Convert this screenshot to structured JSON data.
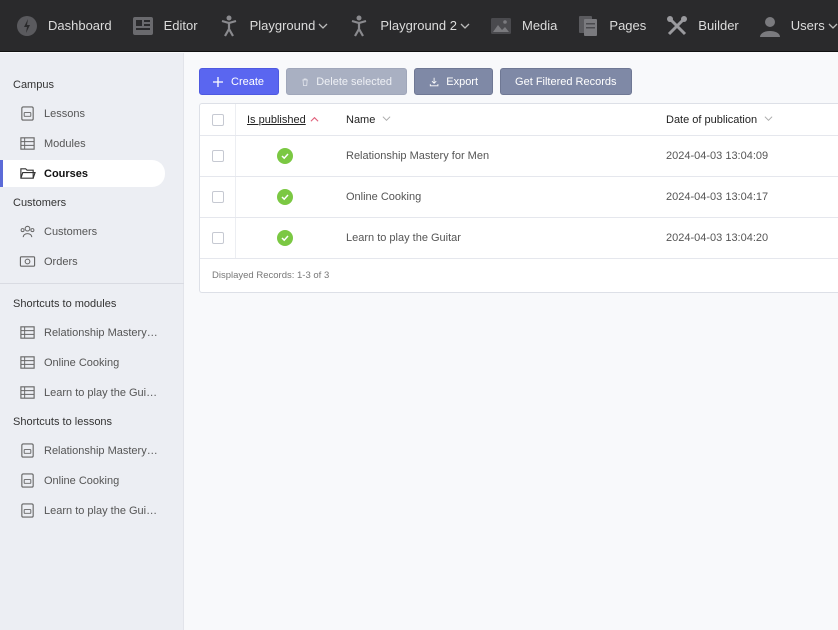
{
  "nav": [
    {
      "label": "Dashboard",
      "icon": "dashboard-icon",
      "dropdown": false
    },
    {
      "label": "Editor",
      "icon": "editor-icon",
      "dropdown": false
    },
    {
      "label": "Playground",
      "icon": "playground-icon",
      "dropdown": true
    },
    {
      "label": "Playground 2",
      "icon": "playground-2-icon",
      "dropdown": true
    },
    {
      "label": "Media",
      "icon": "media-icon",
      "dropdown": false
    },
    {
      "label": "Pages",
      "icon": "pages-icon",
      "dropdown": false
    },
    {
      "label": "Builder",
      "icon": "builder-icon",
      "dropdown": false
    },
    {
      "label": "Users",
      "icon": "users-icon",
      "dropdown": true
    }
  ],
  "sidebar": {
    "sections": [
      {
        "title": "Campus",
        "items": [
          {
            "label": "Lessons",
            "icon": "lesson-icon",
            "active": false
          },
          {
            "label": "Modules",
            "icon": "table-icon",
            "active": false
          },
          {
            "label": "Courses",
            "icon": "folder-icon",
            "active": true
          }
        ]
      },
      {
        "title": "Customers",
        "items": [
          {
            "label": "Customers",
            "icon": "people-icon",
            "active": false
          },
          {
            "label": "Orders",
            "icon": "money-icon",
            "active": false
          }
        ]
      },
      {
        "title": "Shortcuts to modules",
        "items": [
          {
            "label": "Relationship Mastery for Men",
            "icon": "table-icon",
            "active": false
          },
          {
            "label": "Online Cooking",
            "icon": "table-icon",
            "active": false
          },
          {
            "label": "Learn to play the Guitar",
            "icon": "table-icon",
            "active": false
          }
        ]
      },
      {
        "title": "Shortcuts to lessons",
        "items": [
          {
            "label": "Relationship Mastery for Men",
            "icon": "lesson-icon",
            "active": false
          },
          {
            "label": "Online Cooking",
            "icon": "lesson-icon",
            "active": false
          },
          {
            "label": "Learn to play the Guitar",
            "icon": "lesson-icon",
            "active": false
          }
        ]
      }
    ]
  },
  "toolbar": {
    "create": "Create",
    "delete": "Delete selected",
    "export": "Export",
    "filtered": "Get Filtered Records"
  },
  "table": {
    "columns": {
      "published": "Is published",
      "name": "Name",
      "date": "Date of publication"
    },
    "rows": [
      {
        "published": true,
        "name": "Relationship Mastery for Men",
        "date": "2024-04-03 13:04:09"
      },
      {
        "published": true,
        "name": "Online Cooking",
        "date": "2024-04-03 13:04:17"
      },
      {
        "published": true,
        "name": "Learn to play the Guitar",
        "date": "2024-04-03 13:04:20"
      }
    ],
    "footer": "Displayed Records: 1-3 of 3"
  },
  "colors": {
    "accent": "#5a66f0",
    "published": "#7bc843",
    "topbar": "#2a2a2c"
  }
}
